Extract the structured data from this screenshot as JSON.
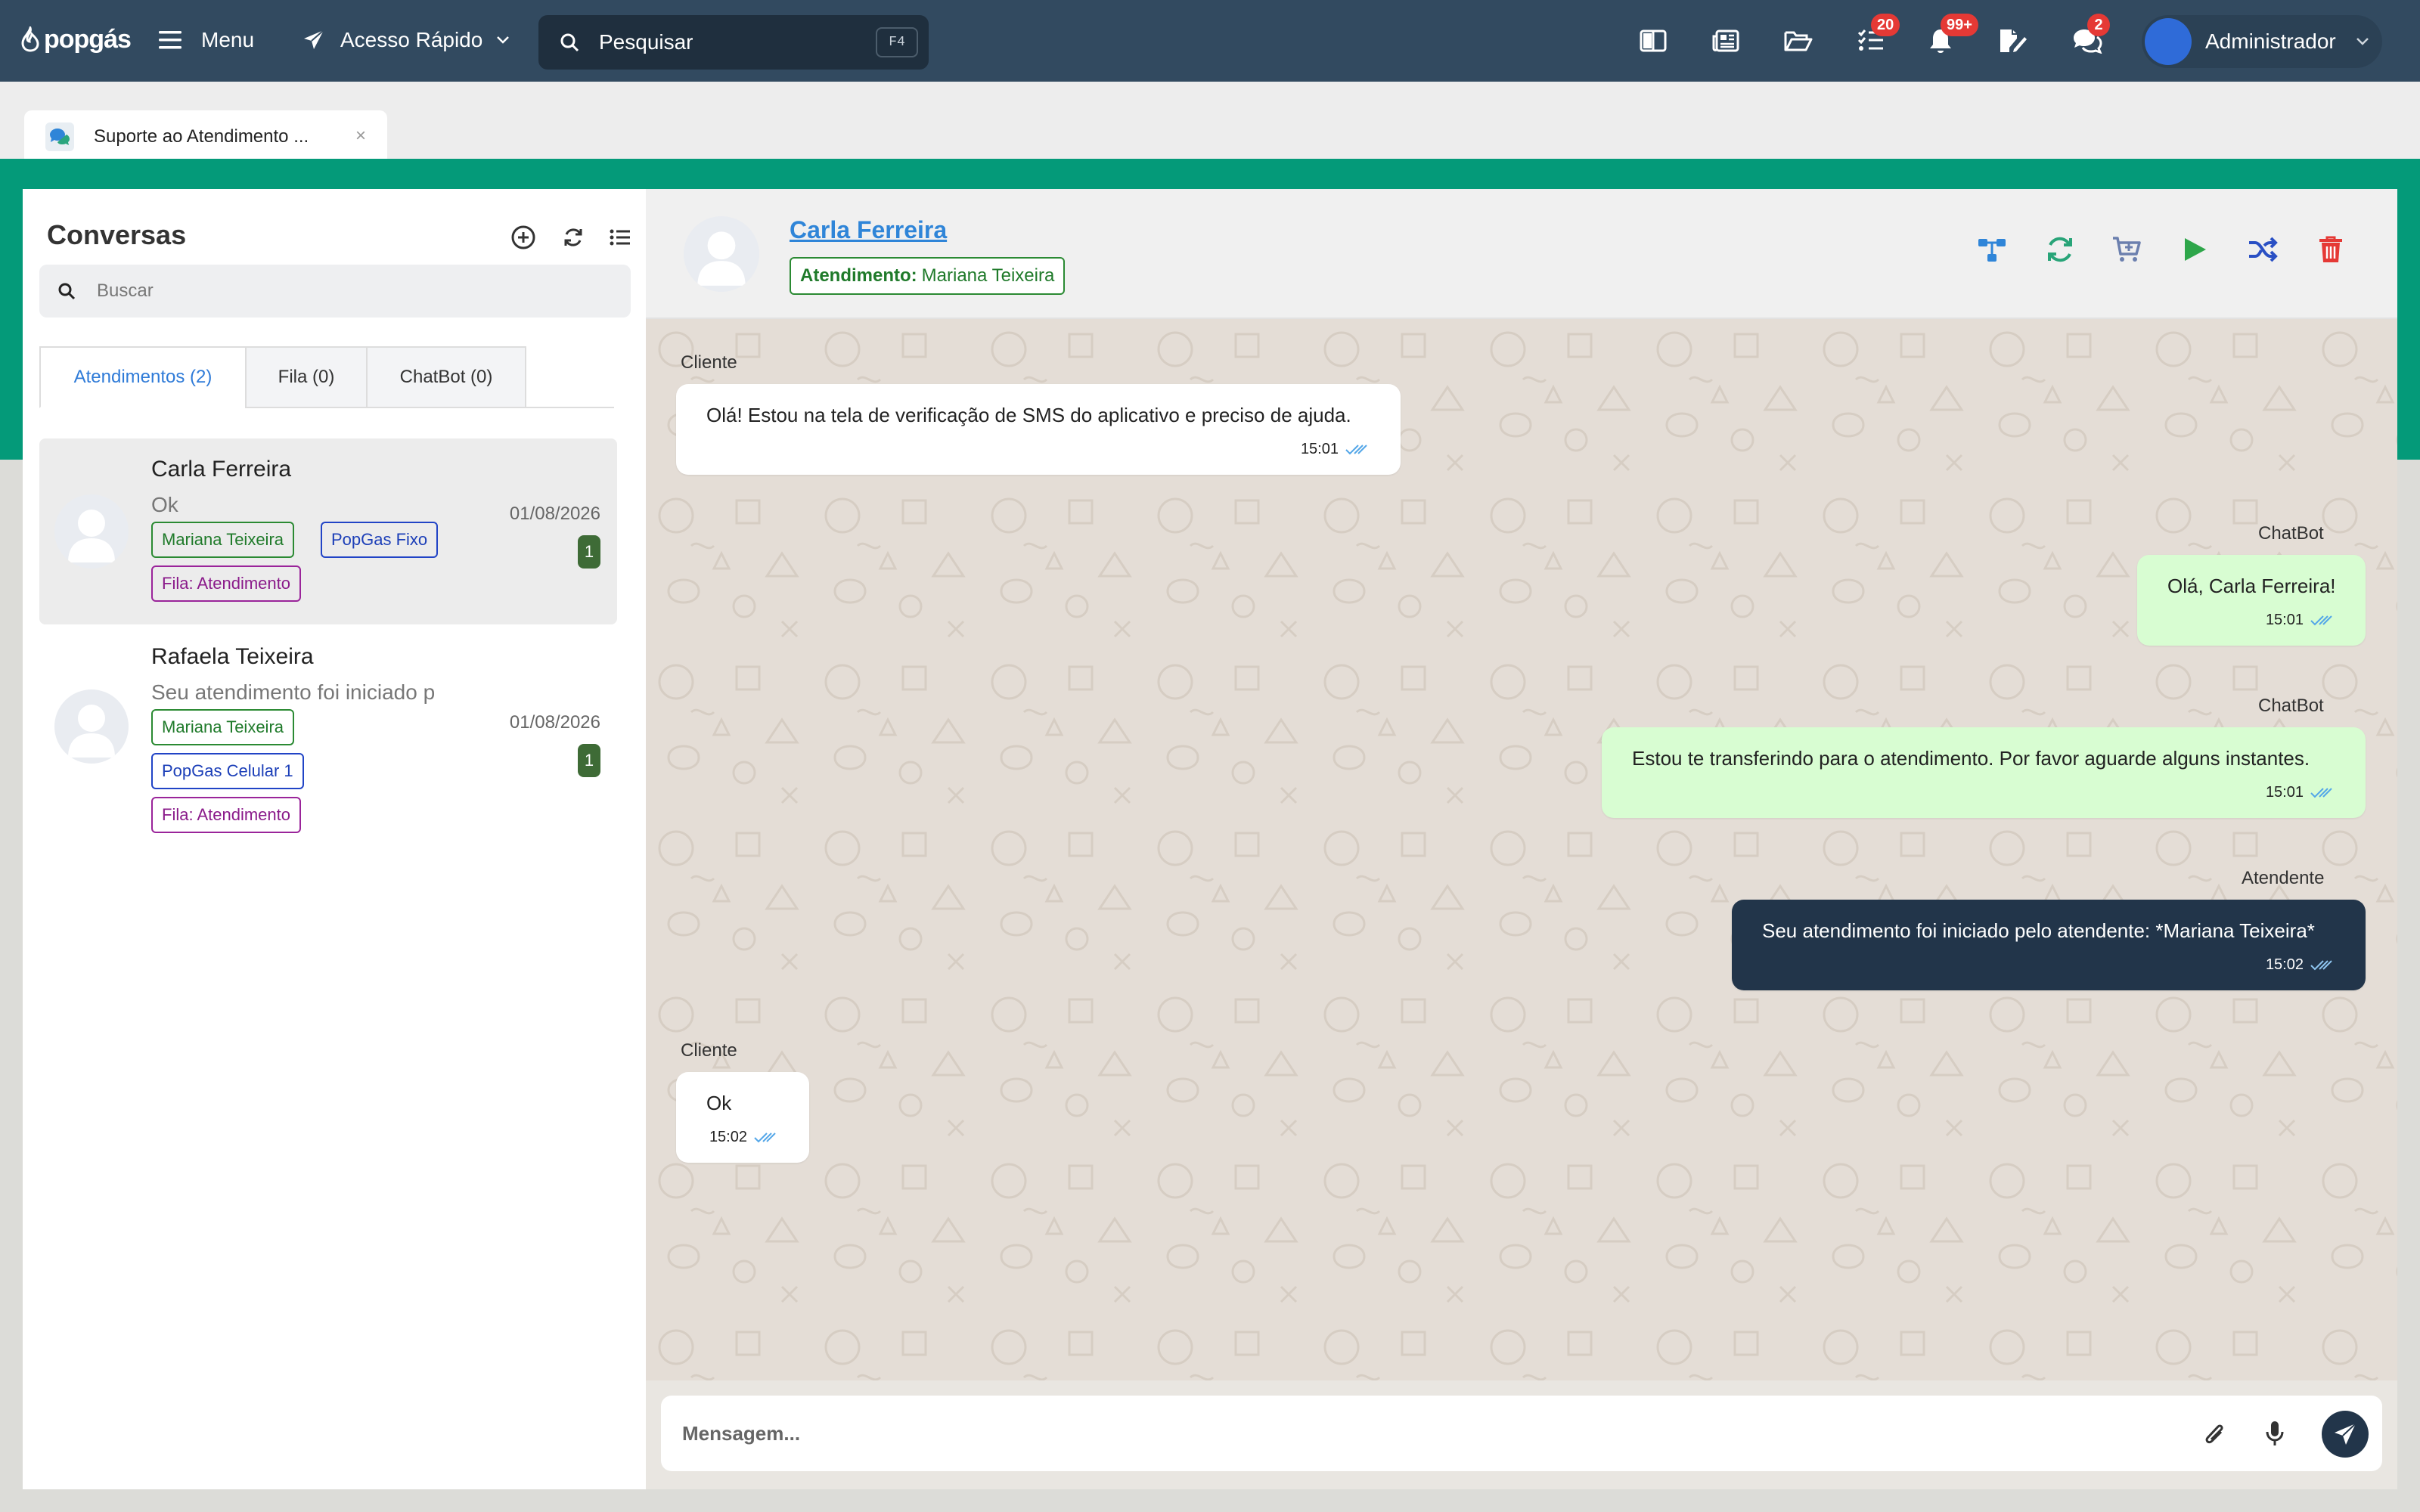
{
  "topbar": {
    "logo": "popgás",
    "menu_label": "Menu",
    "quick_access_label": "Acesso Rápido",
    "search_placeholder": "Pesquisar",
    "search_shortcut": "F4",
    "badges": {
      "tasks": "20",
      "notifications": "99+",
      "chats": "2"
    },
    "user_name": "Administrador",
    "bar_color": "#324a60",
    "accent_color": "#049a79"
  },
  "tab": {
    "label": "Suporte ao Atendimento ...",
    "close": "×"
  },
  "conversations": {
    "title": "Conversas",
    "search_placeholder": "Buscar",
    "tabs": [
      {
        "label": "Atendimentos (2)"
      },
      {
        "label": "Fila (0)"
      },
      {
        "label": "ChatBot (0)"
      }
    ],
    "items": [
      {
        "name": "Carla Ferreira",
        "preview": "Ok",
        "date": "01/08/2026",
        "unread": "1",
        "tags": [
          "Mariana Teixeira",
          "PopGas Fixo",
          "Fila: Atendimento"
        ]
      },
      {
        "name": "Rafaela Teixeira",
        "preview": "Seu atendimento foi iniciado p",
        "date": "01/08/2026",
        "unread": "1",
        "tags": [
          "Mariana Teixeira",
          "PopGas Celular 1",
          "Fila: Atendimento"
        ]
      }
    ]
  },
  "chat": {
    "contact_name": "Carla Ferreira",
    "status_label": "Atendimento:",
    "status_value": "Mariana Teixeira",
    "messages": [
      {
        "sender": "Cliente",
        "text": "Olá! Estou na tela de verificação de SMS do aplicativo e preciso de ajuda.",
        "time": "15:01"
      },
      {
        "sender": "ChatBot",
        "text": "Olá, Carla Ferreira!",
        "time": "15:01"
      },
      {
        "sender": "ChatBot",
        "text": "Estou te transferindo para o atendimento. Por favor aguarde alguns instantes.",
        "time": "15:01"
      },
      {
        "sender": "Atendente",
        "text": "Seu atendimento foi iniciado pelo atendente: *Mariana Teixeira*",
        "time": "15:02"
      },
      {
        "sender": "Cliente",
        "text": "Ok",
        "time": "15:02"
      }
    ],
    "composer_placeholder": "Mensagem..."
  }
}
